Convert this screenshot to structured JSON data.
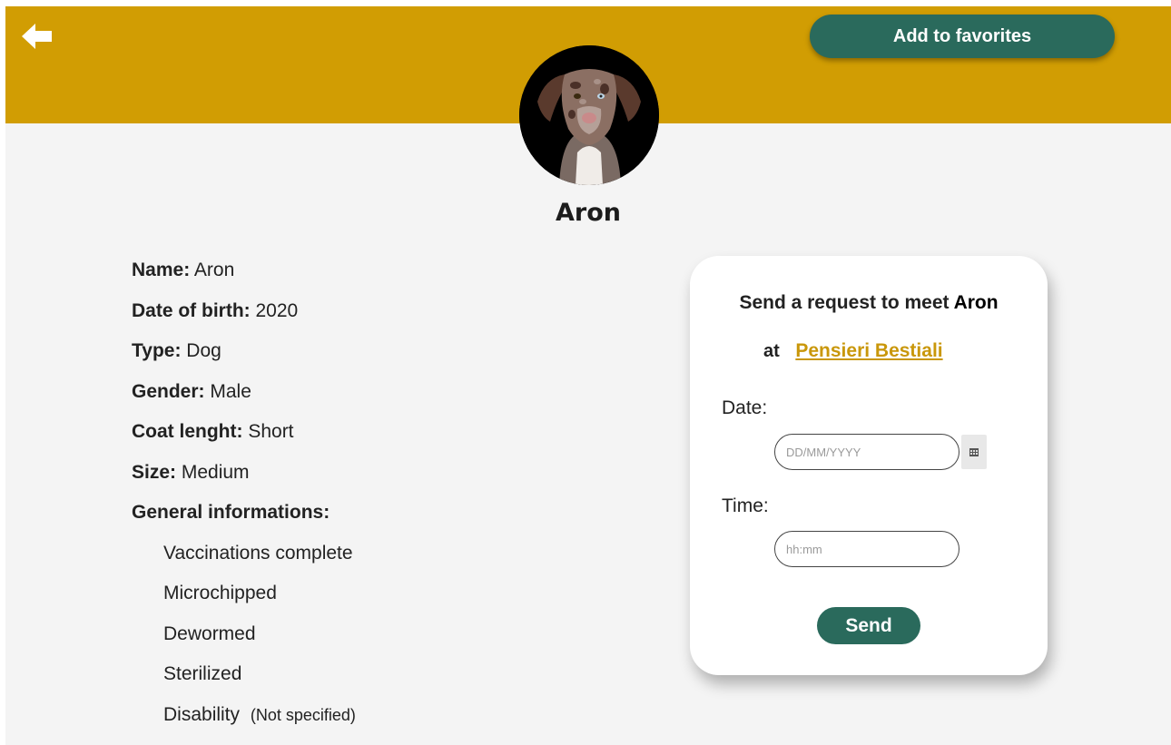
{
  "header": {
    "back_icon": "arrow-left-icon",
    "favorites_label": "Add to favorites",
    "background_color": "#d19d03"
  },
  "pet": {
    "title": "Aron",
    "avatar": "dog-photo"
  },
  "details": {
    "name_label": "Name:",
    "name_value": "Aron",
    "dob_label": "Date of birth:",
    "dob_value": "2020",
    "type_label": "Type:",
    "type_value": "Dog",
    "gender_label": "Gender:",
    "gender_value": "Male",
    "coat_label": "Coat lenght:",
    "coat_value": "Short",
    "size_label": "Size:",
    "size_value": "Medium",
    "general_label": "General informations:",
    "general_items": [
      "Vaccinations complete",
      "Microchipped",
      "Dewormed",
      "Sterilized",
      "Disability"
    ],
    "disability_note": "(Not specified)"
  },
  "request_card": {
    "title_prefix": "Send a request to meet",
    "pet_name": "Aron",
    "at_label": "at",
    "venue": "Pensieri Bestiali",
    "date_label": "Date:",
    "date_placeholder": "DD/MM/YYYY",
    "date_value": "",
    "calendar_icon": "calendar-icon",
    "time_label": "Time:",
    "time_placeholder": "hh:mm",
    "time_value": "",
    "send_label": "Send"
  },
  "colors": {
    "accent_green": "#2a6a5c",
    "link_gold": "#c9970a",
    "page_bg": "#f4f4f4"
  }
}
